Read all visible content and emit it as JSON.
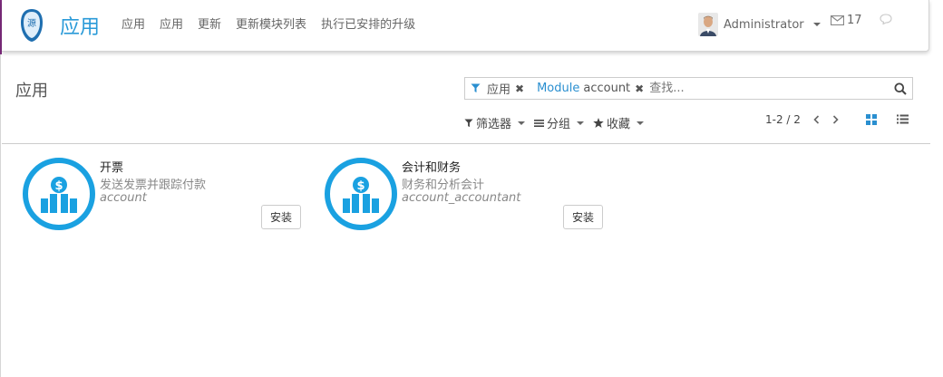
{
  "navbar": {
    "app_title": "应用",
    "menu": [
      "应用",
      "应用",
      "更新",
      "更新模块列表",
      "执行已安排的升级"
    ],
    "user": "Administrator",
    "message_count": "17"
  },
  "control_panel": {
    "title": "应用",
    "search": {
      "facets": [
        {
          "name": "",
          "value": "应用"
        },
        {
          "name": "Module",
          "value": "account"
        }
      ],
      "placeholder": "查找..."
    },
    "filters_label": "筛选器",
    "groupby_label": "分组",
    "favorites_label": "收藏",
    "pager": "1-2 / 2"
  },
  "apps": [
    {
      "name": "开票",
      "summary": "发送发票并跟踪付款",
      "technical_name": "account",
      "button": "安装"
    },
    {
      "name": "会计和财务",
      "summary": "财务和分析会计",
      "technical_name": "account_accountant",
      "button": "安装"
    }
  ],
  "colors": {
    "accent": "#2a9ad8",
    "app_icon_blue": "#1aa1e1"
  }
}
